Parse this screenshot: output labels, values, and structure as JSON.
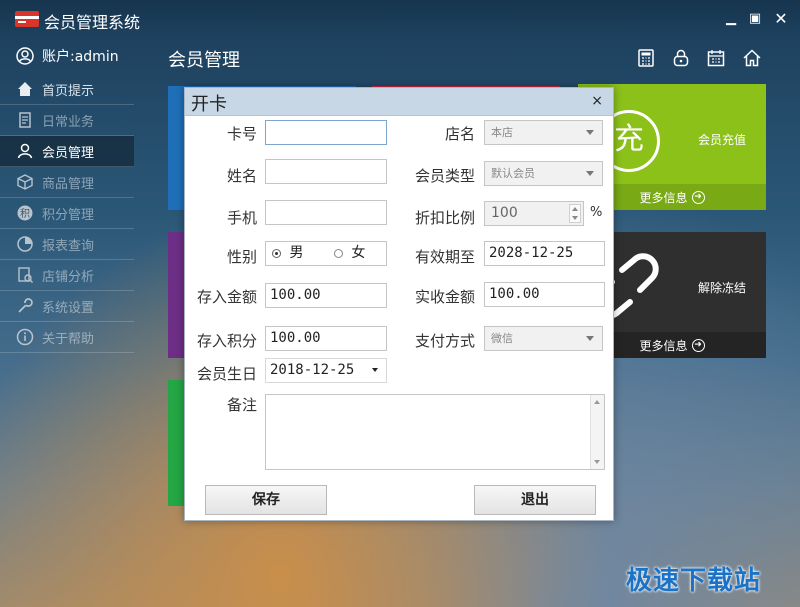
{
  "app": {
    "title": "会员管理系统"
  },
  "account": {
    "label": "账户:admin"
  },
  "sidebar": {
    "items": [
      {
        "label": "首页提示"
      },
      {
        "label": "日常业务"
      },
      {
        "label": "会员管理"
      },
      {
        "label": "商品管理"
      },
      {
        "label": "积分管理"
      },
      {
        "label": "报表查询"
      },
      {
        "label": "店铺分析"
      },
      {
        "label": "系统设置"
      },
      {
        "label": "关于帮助"
      }
    ]
  },
  "main": {
    "title": "会员管理",
    "tiles": [
      {
        "label": "会员充值",
        "glyph": "充",
        "footer": "更多信息",
        "color": "#8cc11a"
      },
      {
        "label": "解除冻结",
        "footer": "更多信息",
        "color": "#2f2f2f"
      }
    ]
  },
  "dialog": {
    "title": "开卡",
    "close": "×",
    "labels": {
      "card_no": "卡号",
      "name": "姓名",
      "phone": "手机",
      "gender": "性别",
      "deposit": "存入金额",
      "points": "存入积分",
      "birthday": "会员生日",
      "note": "备注",
      "store": "店名",
      "member_type": "会员类型",
      "discount": "折扣比例",
      "expiry": "有效期至",
      "received": "实收金额",
      "payment": "支付方式"
    },
    "values": {
      "card_no": "",
      "name": "",
      "phone": "",
      "gender_male": "男",
      "gender_female": "女",
      "deposit": "100.00",
      "points": "100.00",
      "birthday": "2018-12-25",
      "store": "本店",
      "member_type": "默认会员",
      "discount": "100",
      "discount_unit": "%",
      "expiry": "2028-12-25",
      "received": "100.00",
      "payment": "微信",
      "note": ""
    },
    "buttons": {
      "save": "保存",
      "exit": "退出"
    }
  },
  "watermark": "极速下载站",
  "colors": {
    "accent": "#8cc11a",
    "dark_tile": "#2f2f2f",
    "dialog_header": "#c7d7e6"
  }
}
